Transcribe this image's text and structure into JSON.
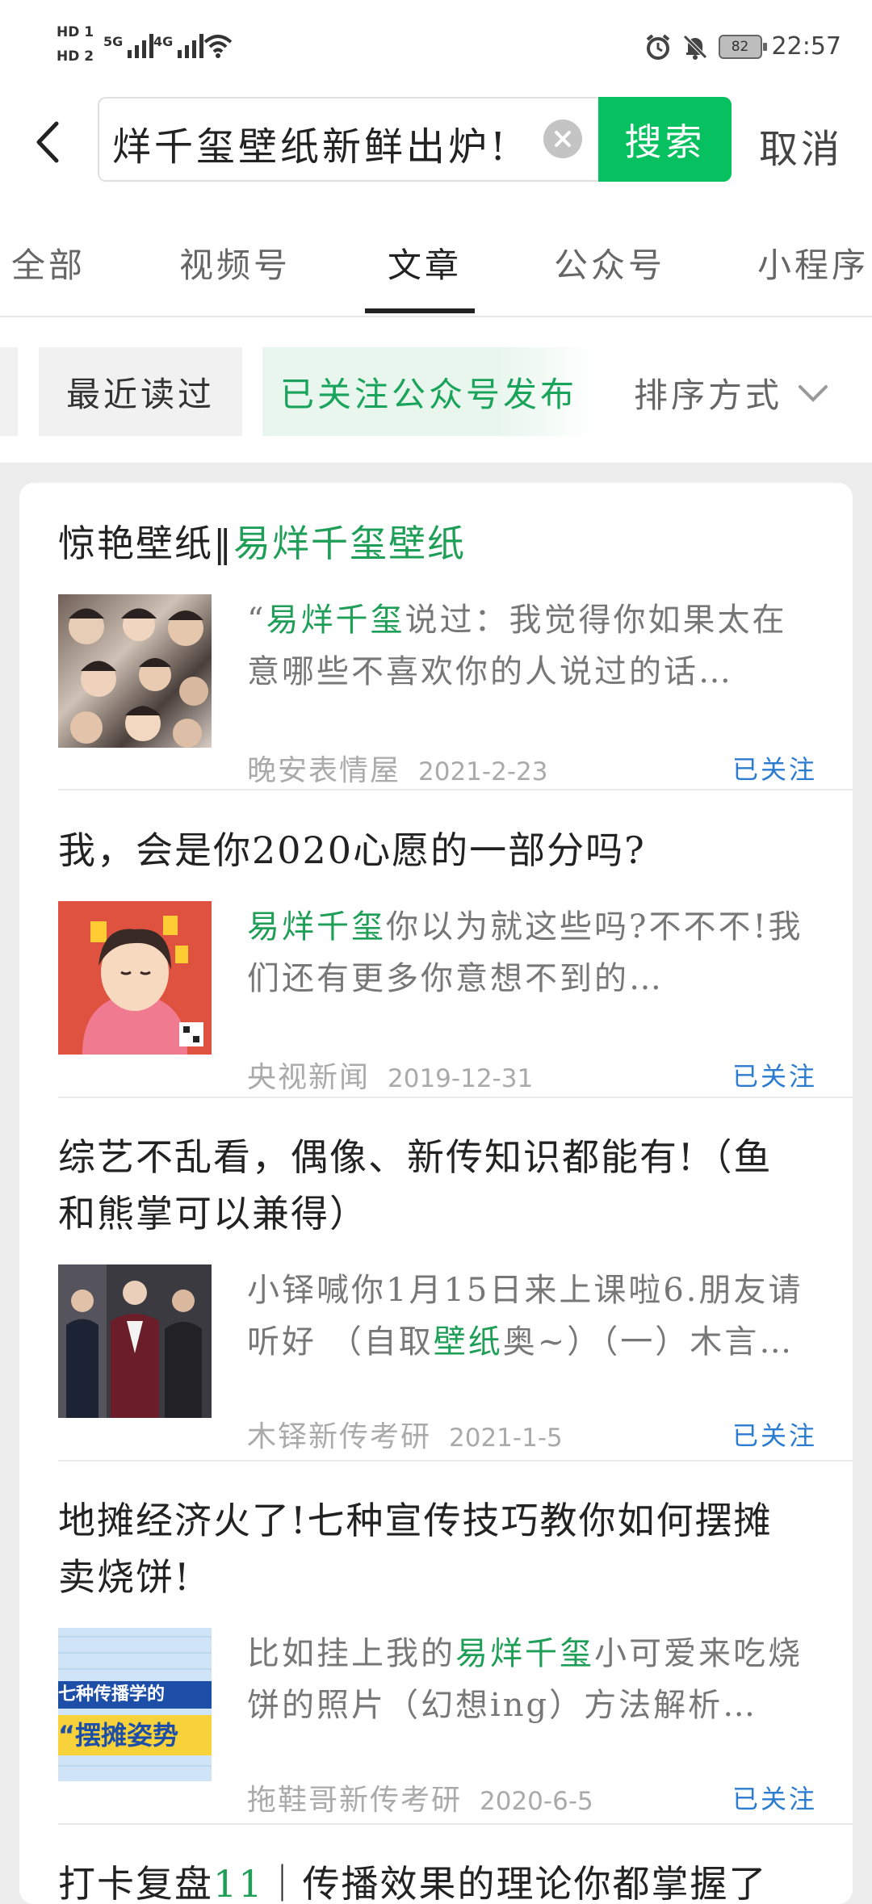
{
  "status_bar": {
    "hd1": "HD 1",
    "hd2": "HD 2",
    "sig1_label": "5G",
    "sig2_label": "4G",
    "battery": "82",
    "time": "22:57"
  },
  "header": {
    "search_value": "烊千玺壁纸新鲜出炉!",
    "search_button": "搜索",
    "cancel_button": "取消"
  },
  "tabs": [
    "全部",
    "视频号",
    "文章",
    "公众号",
    "小程序"
  ],
  "active_tab": "文章",
  "filters": {
    "recent": "最近读过",
    "followed": "已关注公众号发布",
    "sort": "排序方式"
  },
  "colors": {
    "accent": "#07c160",
    "highlight": "#1f9e57",
    "followed_link": "#2b7bd0"
  },
  "results": [
    {
      "title_prefix": "惊艳壁纸‖",
      "title_highlight": "易烊千玺壁纸",
      "snippet_pre": "“",
      "snippet_highlight": "易烊千玺",
      "snippet_post": "说过：我觉得你如果太在意哪些不喜欢你的人说过的话…",
      "source": "晚安表情屋",
      "date": "2021-2-23",
      "followed": "已关注"
    },
    {
      "title": "我，会是你2020心愿的一部分吗?",
      "snippet_highlight": "易烊千玺",
      "snippet_post": "你以为就这些吗?不不不!我们还有更多你意想不到的…",
      "source": "央视新闻",
      "date": "2019-12-31",
      "followed": "已关注"
    },
    {
      "title": "综艺不乱看，偶像、新传知识都能有!（鱼和熊掌可以兼得）",
      "snippet_pre": "小铎喊你1月15日来上课啦6.朋友请听好 （自取",
      "snippet_highlight": "壁纸",
      "snippet_post": "奥~）（一）木言…",
      "source": "木铎新传考研",
      "date": "2021-1-5",
      "followed": "已关注"
    },
    {
      "title": "地摊经济火了!七种宣传技巧教你如何摆摊卖烧饼!",
      "snippet_pre": "比如挂上我的",
      "snippet_highlight": "易烊千玺",
      "snippet_post": "小可爱来吃烧饼的照片（幻想ing）方法解析…",
      "source": "拖鞋哥新传考研",
      "date": "2020-6-5",
      "followed": "已关注",
      "thumb_text_1": "七种传播学的",
      "thumb_text_2": "“摆摊姿势"
    },
    {
      "title_pre": "打卡复盘",
      "title_highlight": "11",
      "title_post": "｜传播效果的理论你都掌握了"
    }
  ]
}
